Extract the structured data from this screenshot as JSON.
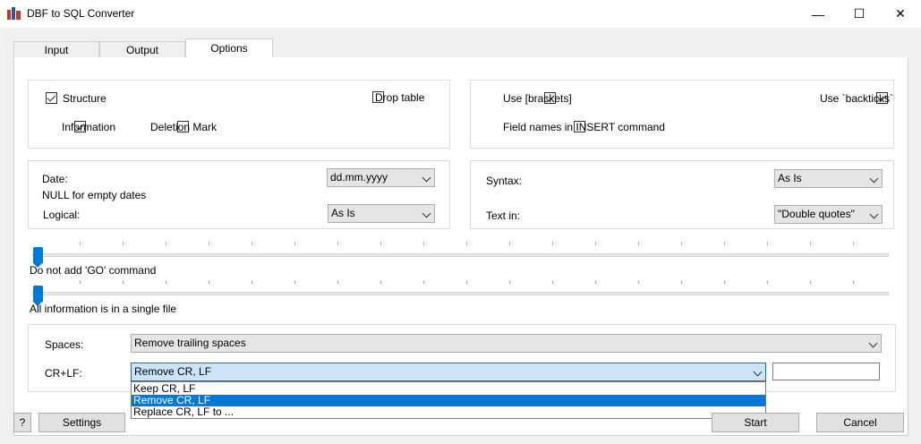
{
  "window": {
    "title": "DBF to SQL Converter",
    "minimize_label": "—",
    "maximize_label": "☐",
    "close_label": "✕"
  },
  "tabs": [
    {
      "label": "Input",
      "active": false
    },
    {
      "label": "Output",
      "active": false
    },
    {
      "label": "Options",
      "active": true
    }
  ],
  "options_group": {
    "structure": {
      "label": "Structure",
      "checked": true
    },
    "drop_table": {
      "label": "Drop table",
      "checked": false
    },
    "information": {
      "label": "Information",
      "checked": true
    },
    "deletion_mark": {
      "label": "Deletion Mark",
      "checked": false
    }
  },
  "quote_group": {
    "use_brackets": {
      "label": "Use [brackets]",
      "checked": true
    },
    "use_backticks": {
      "label": "Use `backticks`",
      "checked": true
    },
    "field_names": {
      "label": "Field names in INSERT command",
      "checked": false
    }
  },
  "date_group": {
    "date_label": "Date:",
    "date_value": "dd.mm.yyyy",
    "null_label": "NULL for empty dates",
    "null_checked": false,
    "logical_label": "Logical:",
    "logical_value": "As Is"
  },
  "syntax_group": {
    "syntax_label": "Syntax:",
    "syntax_value": "As Is",
    "textin_label": "Text in:",
    "textin_value": "\"Double quotes\""
  },
  "slider1": {
    "caption": "Do not add 'GO' command",
    "position": 0
  },
  "slider2": {
    "caption": "All information is in a single file",
    "position": 0
  },
  "bottom_group": {
    "spaces_label": "Spaces:",
    "spaces_value": "Remove trailing spaces",
    "crlf_label": "CR+LF:",
    "crlf_value": "Remove CR, LF",
    "crlf_options": [
      "Keep CR, LF",
      "Remove CR, LF",
      "Replace CR, LF to ..."
    ],
    "crlf_selected_index": 1,
    "replace_text": ""
  },
  "footer": {
    "help_label": "?",
    "settings_label": "Settings",
    "start_label": "Start",
    "cancel_label": "Cancel"
  },
  "colors": {
    "accent": "#0078d7",
    "selection_bg": "#cce4f7"
  }
}
